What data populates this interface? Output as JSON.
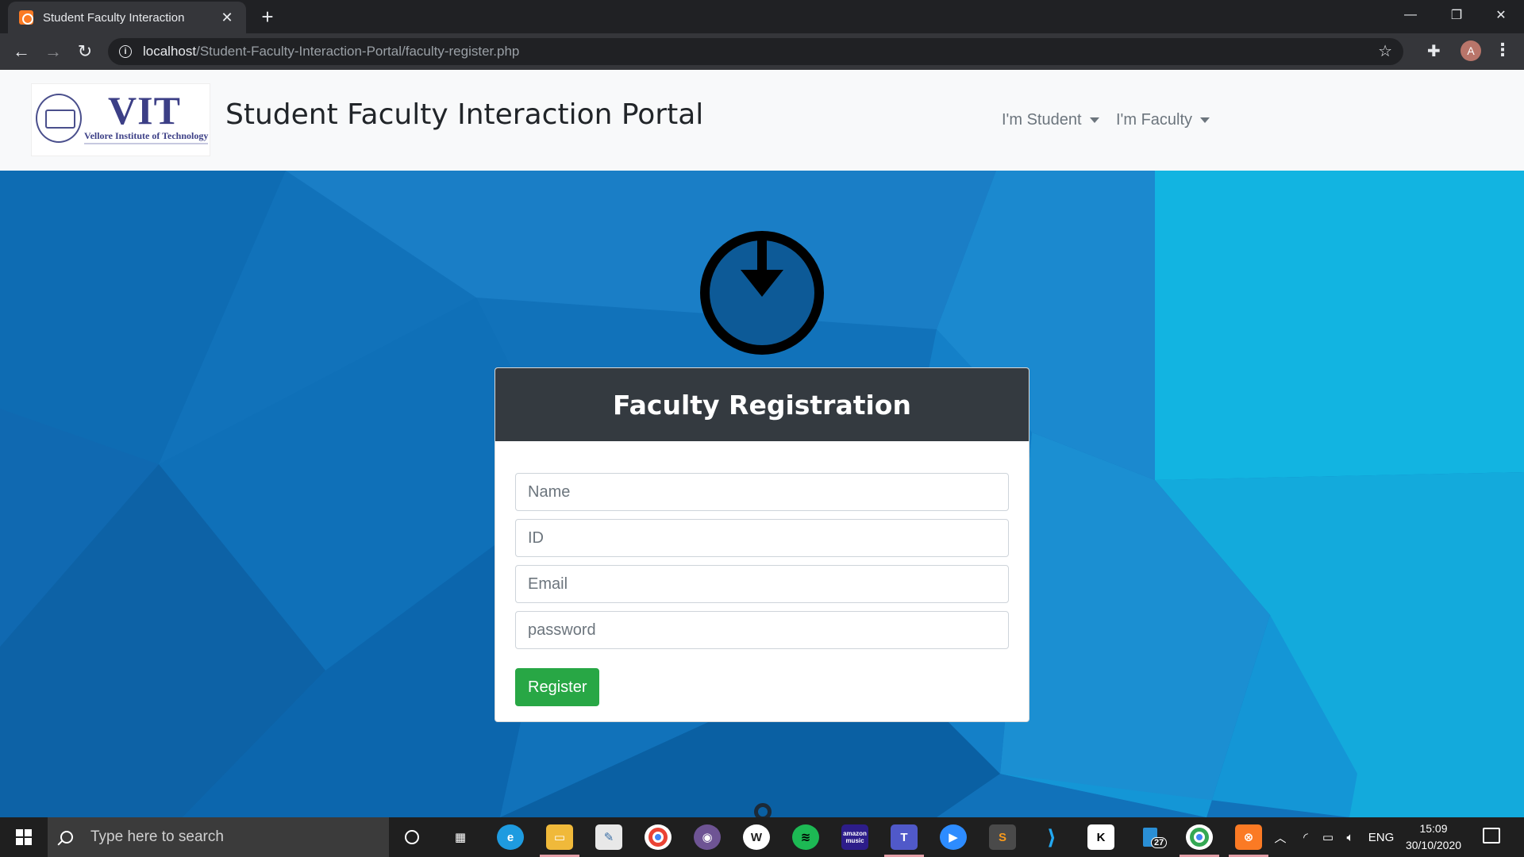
{
  "browser": {
    "tab_title": "Student Faculty Interaction",
    "tab_close": "✕",
    "new_tab": "+",
    "url_host": "localhost",
    "url_path": "/Student-Faculty-Interaction-Portal/faculty-register.php",
    "profile_initial": "A"
  },
  "navbar": {
    "logo_text": "VIT",
    "logo_subtitle": "Vellore Institute of Technology",
    "brand": "Student Faculty Interaction Portal",
    "links": [
      {
        "label": "I'm Student"
      },
      {
        "label": "I'm Faculty"
      }
    ]
  },
  "form": {
    "title": "Faculty Registration",
    "fields": [
      {
        "placeholder": "Name"
      },
      {
        "placeholder": "ID"
      },
      {
        "placeholder": "Email"
      },
      {
        "placeholder": "password"
      }
    ],
    "submit_label": "Register"
  },
  "taskbar": {
    "search_placeholder": "Type here to search",
    "language": "ENG",
    "time": "15:09",
    "date": "30/10/2020",
    "badge_count": "27",
    "amazon_label": "amazon music"
  },
  "colors": {
    "navbar_bg": "#f8f9fa",
    "card_header": "#343a40",
    "button_green": "#28a745",
    "hero_blue": "#1076bd"
  }
}
